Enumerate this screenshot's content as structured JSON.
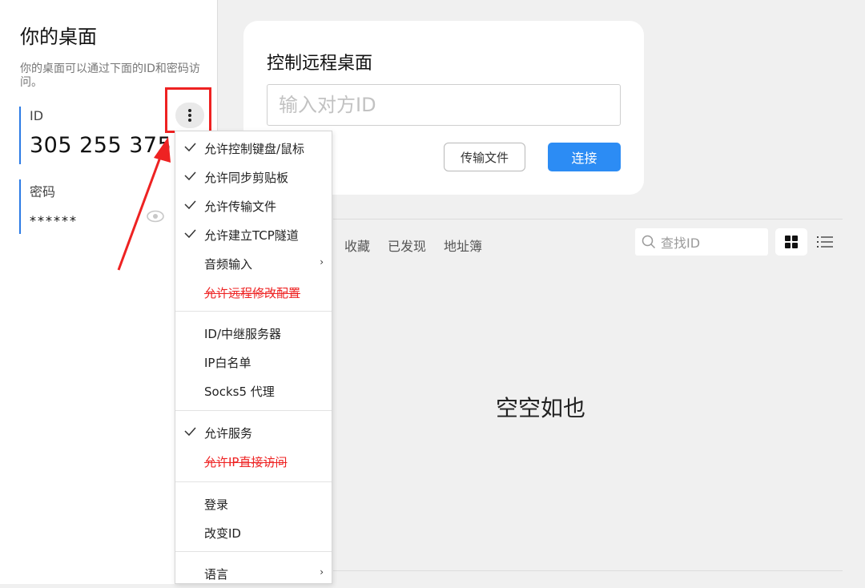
{
  "left": {
    "title": "你的桌面",
    "description": "你的桌面可以通过下面的ID和密码访问。",
    "id_label": "ID",
    "id_value": "305 255 375",
    "password_label": "密码",
    "password_value": "******"
  },
  "card": {
    "title": "控制远程桌面",
    "input_placeholder": "输入对方ID",
    "transfer_button": "传输文件",
    "connect_button": "连接"
  },
  "tabs": [
    "收藏",
    "已发现",
    "地址簿"
  ],
  "search_placeholder": "查找ID",
  "empty_text": "空空如也",
  "menu": {
    "items": [
      {
        "label": "允许控制键盘/鼠标",
        "checked": true
      },
      {
        "label": "允许同步剪贴板",
        "checked": true
      },
      {
        "label": "允许传输文件",
        "checked": true
      },
      {
        "label": "允许建立TCP隧道",
        "checked": true
      },
      {
        "label": "音频输入",
        "submenu": true
      },
      {
        "label": "允许远程修改配置",
        "strikethrough": true
      },
      {
        "label": "ID/中继服务器"
      },
      {
        "label": "IP白名单"
      },
      {
        "label": "Socks5 代理"
      },
      {
        "label": "允许服务",
        "checked": true
      },
      {
        "label": "允许IP直接访问",
        "strikethrough": true
      },
      {
        "label": "登录"
      },
      {
        "label": "改变ID"
      },
      {
        "label": "语言",
        "submenu": true
      }
    ],
    "submenu_glyph": "›"
  },
  "colors": {
    "accent": "#2c8cf4",
    "highlight": "#ee2222",
    "id_bar": "#2c7be5"
  }
}
